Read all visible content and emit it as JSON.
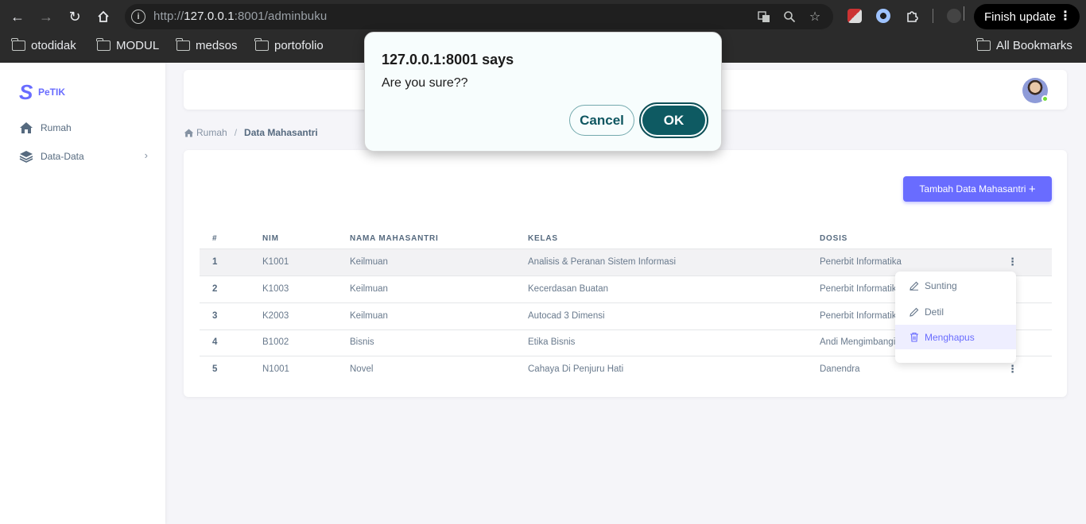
{
  "browser": {
    "url_host": "127.0.0.1",
    "url_rest": ":8001/adminbuku",
    "url_scheme": "http://",
    "finish_update_label": "Finish update",
    "bookmarks": [
      "otodidak",
      "MODUL",
      "medsos",
      "portofolio"
    ],
    "all_bookmarks_label": "All Bookmarks"
  },
  "sidebar": {
    "brand": "PeTIK",
    "items": [
      {
        "label": "Rumah",
        "icon": "home-icon"
      },
      {
        "label": "Data-Data",
        "icon": "layers-icon"
      }
    ]
  },
  "breadcrumb": {
    "home": "Rumah",
    "current": "Data Mahasantri"
  },
  "main": {
    "add_button_label": "Tambah Data Mahasantri",
    "table": {
      "headers": [
        "#",
        "NIM",
        "NAMA MAHASANTRI",
        "KELAS",
        "DOSIS"
      ],
      "rows": [
        {
          "no": "1",
          "nim": "K1001",
          "nama": "Keilmuan",
          "kelas": "Analisis & Peranan Sistem Informasi",
          "dosis": "Penerbit Informatika"
        },
        {
          "no": "2",
          "nim": "K1003",
          "nama": "Keilmuan",
          "kelas": "Kecerdasan Buatan",
          "dosis": "Penerbit Informatika"
        },
        {
          "no": "3",
          "nim": "K2003",
          "nama": "Keilmuan",
          "kelas": "Autocad 3 Dimensi",
          "dosis": "Penerbit Informatika"
        },
        {
          "no": "4",
          "nim": "B1002",
          "nama": "Bisnis",
          "kelas": "Etika Bisnis",
          "dosis": "Andi Mengimbangi"
        },
        {
          "no": "5",
          "nim": "N1001",
          "nama": "Novel",
          "kelas": "Cahaya Di Penjuru Hati",
          "dosis": "Danendra"
        }
      ]
    },
    "row_menu": [
      "Sunting",
      "Detil",
      "Menghapus"
    ]
  },
  "dialog": {
    "title": "127.0.0.1:8001 says",
    "message": "Are you sure??",
    "cancel_label": "Cancel",
    "ok_label": "OK"
  },
  "colors": {
    "accent": "#696cff",
    "dialog_button": "#0e5a62",
    "chrome_bg": "#2b2b2b"
  }
}
